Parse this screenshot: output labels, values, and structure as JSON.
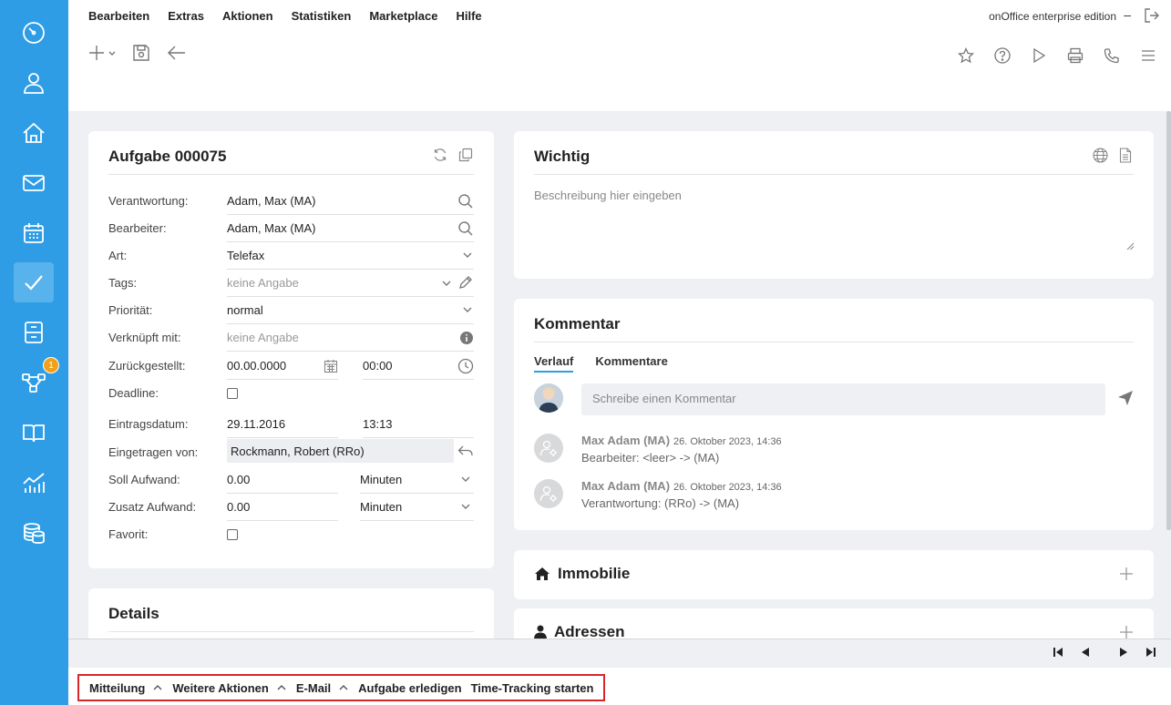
{
  "menu": [
    "Bearbeiten",
    "Extras",
    "Aktionen",
    "Statistiken",
    "Marketplace",
    "Hilfe"
  ],
  "edition": "onOffice enterprise edition",
  "edition_min": "–",
  "sidebar": {
    "badge_count": "1",
    "active_item": "tasks"
  },
  "task": {
    "title": "Aufgabe 000075",
    "fields": {
      "verantwortung": {
        "label": "Verantwortung:",
        "value": "Adam, Max (MA)"
      },
      "bearbeiter": {
        "label": "Bearbeiter:",
        "value": "Adam, Max (MA)"
      },
      "art": {
        "label": "Art:",
        "value": "Telefax"
      },
      "tags": {
        "label": "Tags:",
        "value": "keine Angabe"
      },
      "prioritaet": {
        "label": "Priorität:",
        "value": "normal"
      },
      "verknuepft": {
        "label": "Verknüpft mit:",
        "value": "keine Angabe"
      },
      "zurueckgestellt": {
        "label": "Zurückgestellt:",
        "date": "00.00.0000",
        "time": "00:00"
      },
      "deadline": {
        "label": "Deadline:"
      },
      "eintragsdatum": {
        "label": "Eintragsdatum:",
        "date": "29.11.2016",
        "time": "13:13"
      },
      "eingetragen": {
        "label": "Eingetragen von:",
        "value": "Rockmann, Robert (RRo)"
      },
      "soll": {
        "label": "Soll Aufwand:",
        "value": "0.00",
        "unit": "Minuten"
      },
      "zusatz": {
        "label": "Zusatz Aufwand:",
        "value": "0.00",
        "unit": "Minuten"
      },
      "favorit": {
        "label": "Favorit:"
      }
    }
  },
  "details_title": "Details",
  "wichtig": {
    "title": "Wichtig",
    "placeholder": "Beschreibung hier eingeben"
  },
  "kommentar": {
    "title": "Kommentar",
    "tabs": [
      "Verlauf",
      "Kommentare"
    ],
    "input_placeholder": "Schreibe einen Kommentar",
    "history": [
      {
        "who": "Max Adam (MA)",
        "when": "26. Oktober 2023, 14:36",
        "what": "Bearbeiter: <leer> -> (MA)"
      },
      {
        "who": "Max Adam (MA)",
        "when": "26. Oktober 2023, 14:36",
        "what": "Verantwortung: (RRo) -> (MA)"
      }
    ]
  },
  "immobilie_title": "Immobilie",
  "adressen_title": "Adressen",
  "actions": [
    "Mitteilung",
    "Weitere Aktionen",
    "E-Mail",
    "Aufgabe erledigen",
    "Time-Tracking starten"
  ],
  "colors": {
    "sidebar": "#2e9de6",
    "accent": "#2e9de6",
    "badge": "#f0a11b",
    "highlight": "#d9262c"
  }
}
